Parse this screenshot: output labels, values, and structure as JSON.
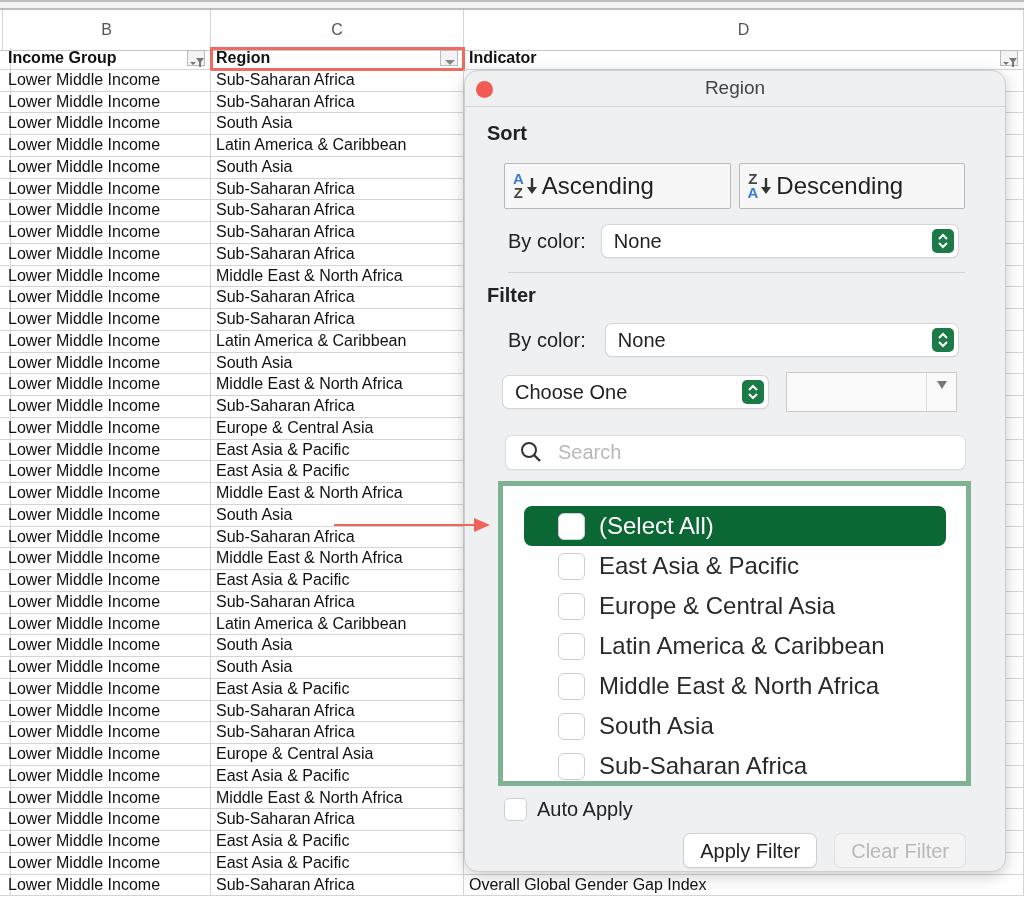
{
  "sheet": {
    "column_letters": [
      "B",
      "C",
      "D"
    ],
    "header": [
      {
        "label": "Income Group",
        "filtered": true,
        "highlighted": false
      },
      {
        "label": "Region",
        "filtered": false,
        "highlighted": true
      },
      {
        "label": "Indicator",
        "filtered": true,
        "highlighted": false
      }
    ],
    "rows": [
      [
        "Lower Middle Income",
        "Sub-Saharan Africa"
      ],
      [
        "Lower Middle Income",
        "Sub-Saharan Africa"
      ],
      [
        "Lower Middle Income",
        "South Asia"
      ],
      [
        "Lower Middle Income",
        "Latin America & Caribbean"
      ],
      [
        "Lower Middle Income",
        "South Asia"
      ],
      [
        "Lower Middle Income",
        "Sub-Saharan Africa"
      ],
      [
        "Lower Middle Income",
        "Sub-Saharan Africa"
      ],
      [
        "Lower Middle Income",
        "Sub-Saharan Africa"
      ],
      [
        "Lower Middle Income",
        "Sub-Saharan Africa"
      ],
      [
        "Lower Middle Income",
        "Middle East & North Africa"
      ],
      [
        "Lower Middle Income",
        "Sub-Saharan Africa"
      ],
      [
        "Lower Middle Income",
        "Sub-Saharan Africa"
      ],
      [
        "Lower Middle Income",
        "Latin America & Caribbean"
      ],
      [
        "Lower Middle Income",
        "South Asia"
      ],
      [
        "Lower Middle Income",
        "Middle East & North Africa"
      ],
      [
        "Lower Middle Income",
        "Sub-Saharan Africa"
      ],
      [
        "Lower Middle Income",
        "Europe & Central Asia"
      ],
      [
        "Lower Middle Income",
        "East Asia & Pacific"
      ],
      [
        "Lower Middle Income",
        "East Asia & Pacific"
      ],
      [
        "Lower Middle Income",
        "Middle East & North Africa"
      ],
      [
        "Lower Middle Income",
        "South Asia"
      ],
      [
        "Lower Middle Income",
        "Sub-Saharan Africa"
      ],
      [
        "Lower Middle Income",
        "Middle East & North Africa"
      ],
      [
        "Lower Middle Income",
        "East Asia & Pacific"
      ],
      [
        "Lower Middle Income",
        "Sub-Saharan Africa"
      ],
      [
        "Lower Middle Income",
        "Latin America & Caribbean"
      ],
      [
        "Lower Middle Income",
        "South Asia"
      ],
      [
        "Lower Middle Income",
        "South Asia"
      ],
      [
        "Lower Middle Income",
        "East Asia & Pacific"
      ],
      [
        "Lower Middle Income",
        "Sub-Saharan Africa"
      ],
      [
        "Lower Middle Income",
        "Sub-Saharan Africa"
      ],
      [
        "Lower Middle Income",
        "Europe & Central Asia"
      ],
      [
        "Lower Middle Income",
        "East Asia & Pacific"
      ],
      [
        "Lower Middle Income",
        "Middle East & North Africa"
      ],
      [
        "Lower Middle Income",
        "Sub-Saharan Africa"
      ],
      [
        "Lower Middle Income",
        "East Asia & Pacific"
      ],
      [
        "Lower Middle Income",
        "East Asia & Pacific"
      ],
      [
        "Lower Middle Income",
        "Sub-Saharan Africa",
        "Overall Global Gender Gap Index"
      ]
    ]
  },
  "popup": {
    "title": "Region",
    "sort": {
      "heading": "Sort",
      "buttons": [
        {
          "label": "Ascending",
          "kind": "ascending",
          "icon_top": "A",
          "icon_bottom": "Z"
        },
        {
          "label": "Descending",
          "kind": "descending",
          "icon_top": "Z",
          "icon_bottom": "A"
        }
      ],
      "by_color_label": "By color:",
      "by_color_value": "None"
    },
    "filter": {
      "heading": "Filter",
      "by_color_label": "By color:",
      "by_color_value": "None",
      "condition": "Choose One",
      "search_placeholder": "Search",
      "items": [
        {
          "label": "(Select All)",
          "checked": false,
          "selected": true
        },
        {
          "label": "East Asia & Pacific",
          "checked": false,
          "selected": false
        },
        {
          "label": "Europe & Central Asia",
          "checked": false,
          "selected": false
        },
        {
          "label": "Latin America & Caribbean",
          "checked": false,
          "selected": false
        },
        {
          "label": "Middle East & North Africa",
          "checked": false,
          "selected": false
        },
        {
          "label": "South Asia",
          "checked": false,
          "selected": false
        },
        {
          "label": "Sub-Saharan Africa",
          "checked": false,
          "selected": false
        }
      ],
      "auto_apply": {
        "label": "Auto Apply",
        "checked": false
      },
      "buttons": [
        {
          "label": "Apply Filter",
          "disabled": false
        },
        {
          "label": "Clear Filter",
          "disabled": true
        }
      ]
    }
  }
}
